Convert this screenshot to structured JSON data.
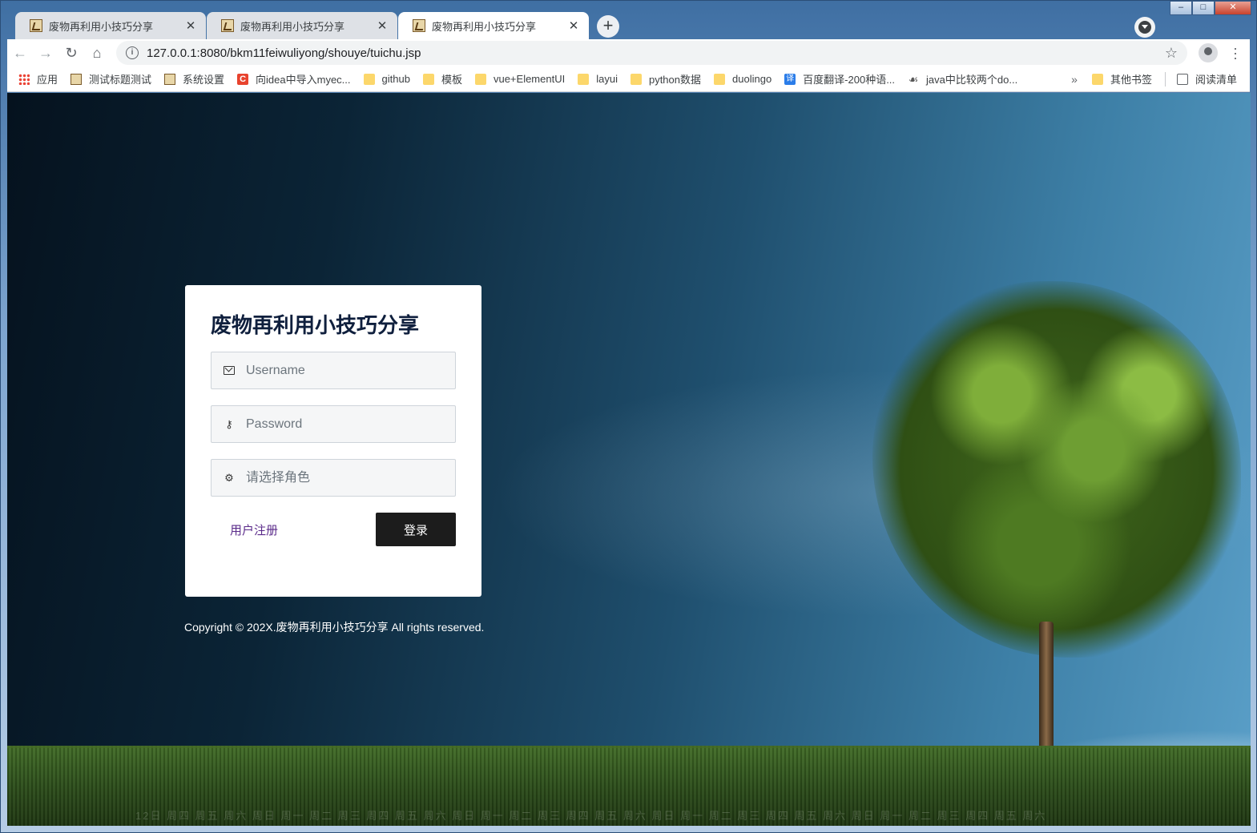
{
  "browser": {
    "tabs": [
      {
        "title": "废物再利用小技巧分享",
        "active": false
      },
      {
        "title": "废物再利用小技巧分享",
        "active": false
      },
      {
        "title": "废物再利用小技巧分享",
        "active": true
      }
    ],
    "new_tab_label": "+",
    "url": "127.0.0.1:8080/bkm11feiwuliyong/shouye/tuichu.jsp",
    "bookmarks": [
      {
        "label": "应用",
        "icon": "apps-grid-icon"
      },
      {
        "label": "测试标题测试",
        "icon": "image-icon"
      },
      {
        "label": "系统设置",
        "icon": "image-icon"
      },
      {
        "label": "向idea中导入myec...",
        "icon": "c-icon"
      },
      {
        "label": "github",
        "icon": "folder-icon"
      },
      {
        "label": "模板",
        "icon": "folder-icon"
      },
      {
        "label": "vue+ElementUI",
        "icon": "folder-icon"
      },
      {
        "label": "layui",
        "icon": "folder-icon"
      },
      {
        "label": "python数据",
        "icon": "folder-icon"
      },
      {
        "label": "duolingo",
        "icon": "folder-icon"
      },
      {
        "label": "百度翻译-200种语...",
        "icon": "translate-icon"
      },
      {
        "label": "java中比较两个do...",
        "icon": "java-icon"
      }
    ],
    "bookmarks_more": "»",
    "other_bookmarks": "其他书签",
    "reading_list": "阅读清单"
  },
  "login": {
    "title": "废物再利用小技巧分享",
    "username_placeholder": "Username",
    "password_placeholder": "Password",
    "role_placeholder": "请选择角色",
    "register_label": "用户注册",
    "login_label": "登录"
  },
  "footer": {
    "copyright": "Copyright © 202X.废物再利用小技巧分享 All rights reserved."
  },
  "background": {
    "day_strip": "12日 周四 周五 周六 周日 周一 周二 周三 周四 周五 周六 周日 周一 周二 周三 周四 周五 周六 周日 周一 周二 周三 周四 周五 周六 周日 周一 周二 周三 周四 周五 周六"
  }
}
